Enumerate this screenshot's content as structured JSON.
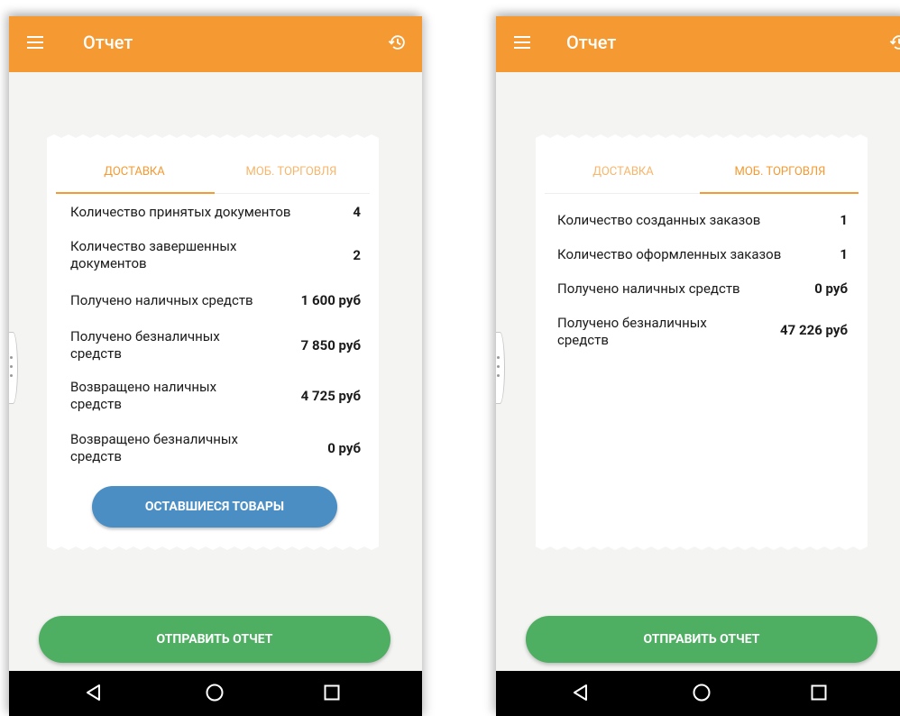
{
  "screens": [
    {
      "appbar": {
        "title": "Отчет",
        "menu_icon": "menu-icon",
        "history_icon": "history-icon"
      },
      "tabs": [
        {
          "label": "ДОСТАВКА",
          "active": true
        },
        {
          "label": "МОБ. ТОРГОВЛЯ",
          "active": false
        }
      ],
      "rows": [
        {
          "label": "Количество принятых документов",
          "value": "4"
        },
        {
          "label": "Количество завершенных документов",
          "value": "2"
        },
        {
          "label": "Получено наличных средств",
          "value": "1 600 руб"
        },
        {
          "label": "Получено безналичных средств",
          "value": "7 850 руб"
        },
        {
          "label": "Возвращено наличных средств",
          "value": "4 725 руб"
        },
        {
          "label": "Возвращено безналичных средств",
          "value": "0 руб"
        }
      ],
      "leftover_button": "ОСТАВШИЕСЯ ТОВАРЫ",
      "send_button": "ОТПРАВИТЬ ОТЧЕТ"
    },
    {
      "appbar": {
        "title": "Отчет",
        "menu_icon": "menu-icon",
        "history_icon": "history-icon"
      },
      "tabs": [
        {
          "label": "ДОСТАВКА",
          "active": false
        },
        {
          "label": "МОБ. ТОРГОВЛЯ",
          "active": true
        }
      ],
      "rows": [
        {
          "label": "Количество созданных заказов",
          "value": "1"
        },
        {
          "label": "Количество оформленных заказов",
          "value": "1"
        },
        {
          "label": "Получено наличных средств",
          "value": "0 руб"
        },
        {
          "label": "Получено безналичных средств",
          "value": "47 226 руб"
        }
      ],
      "send_button": "ОТПРАВИТЬ ОТЧЕТ"
    }
  ],
  "colors": {
    "accent": "#f59a32",
    "blue_button": "#4a8ec4",
    "green_button": "#4eae62",
    "background": "#f4f4f2"
  }
}
